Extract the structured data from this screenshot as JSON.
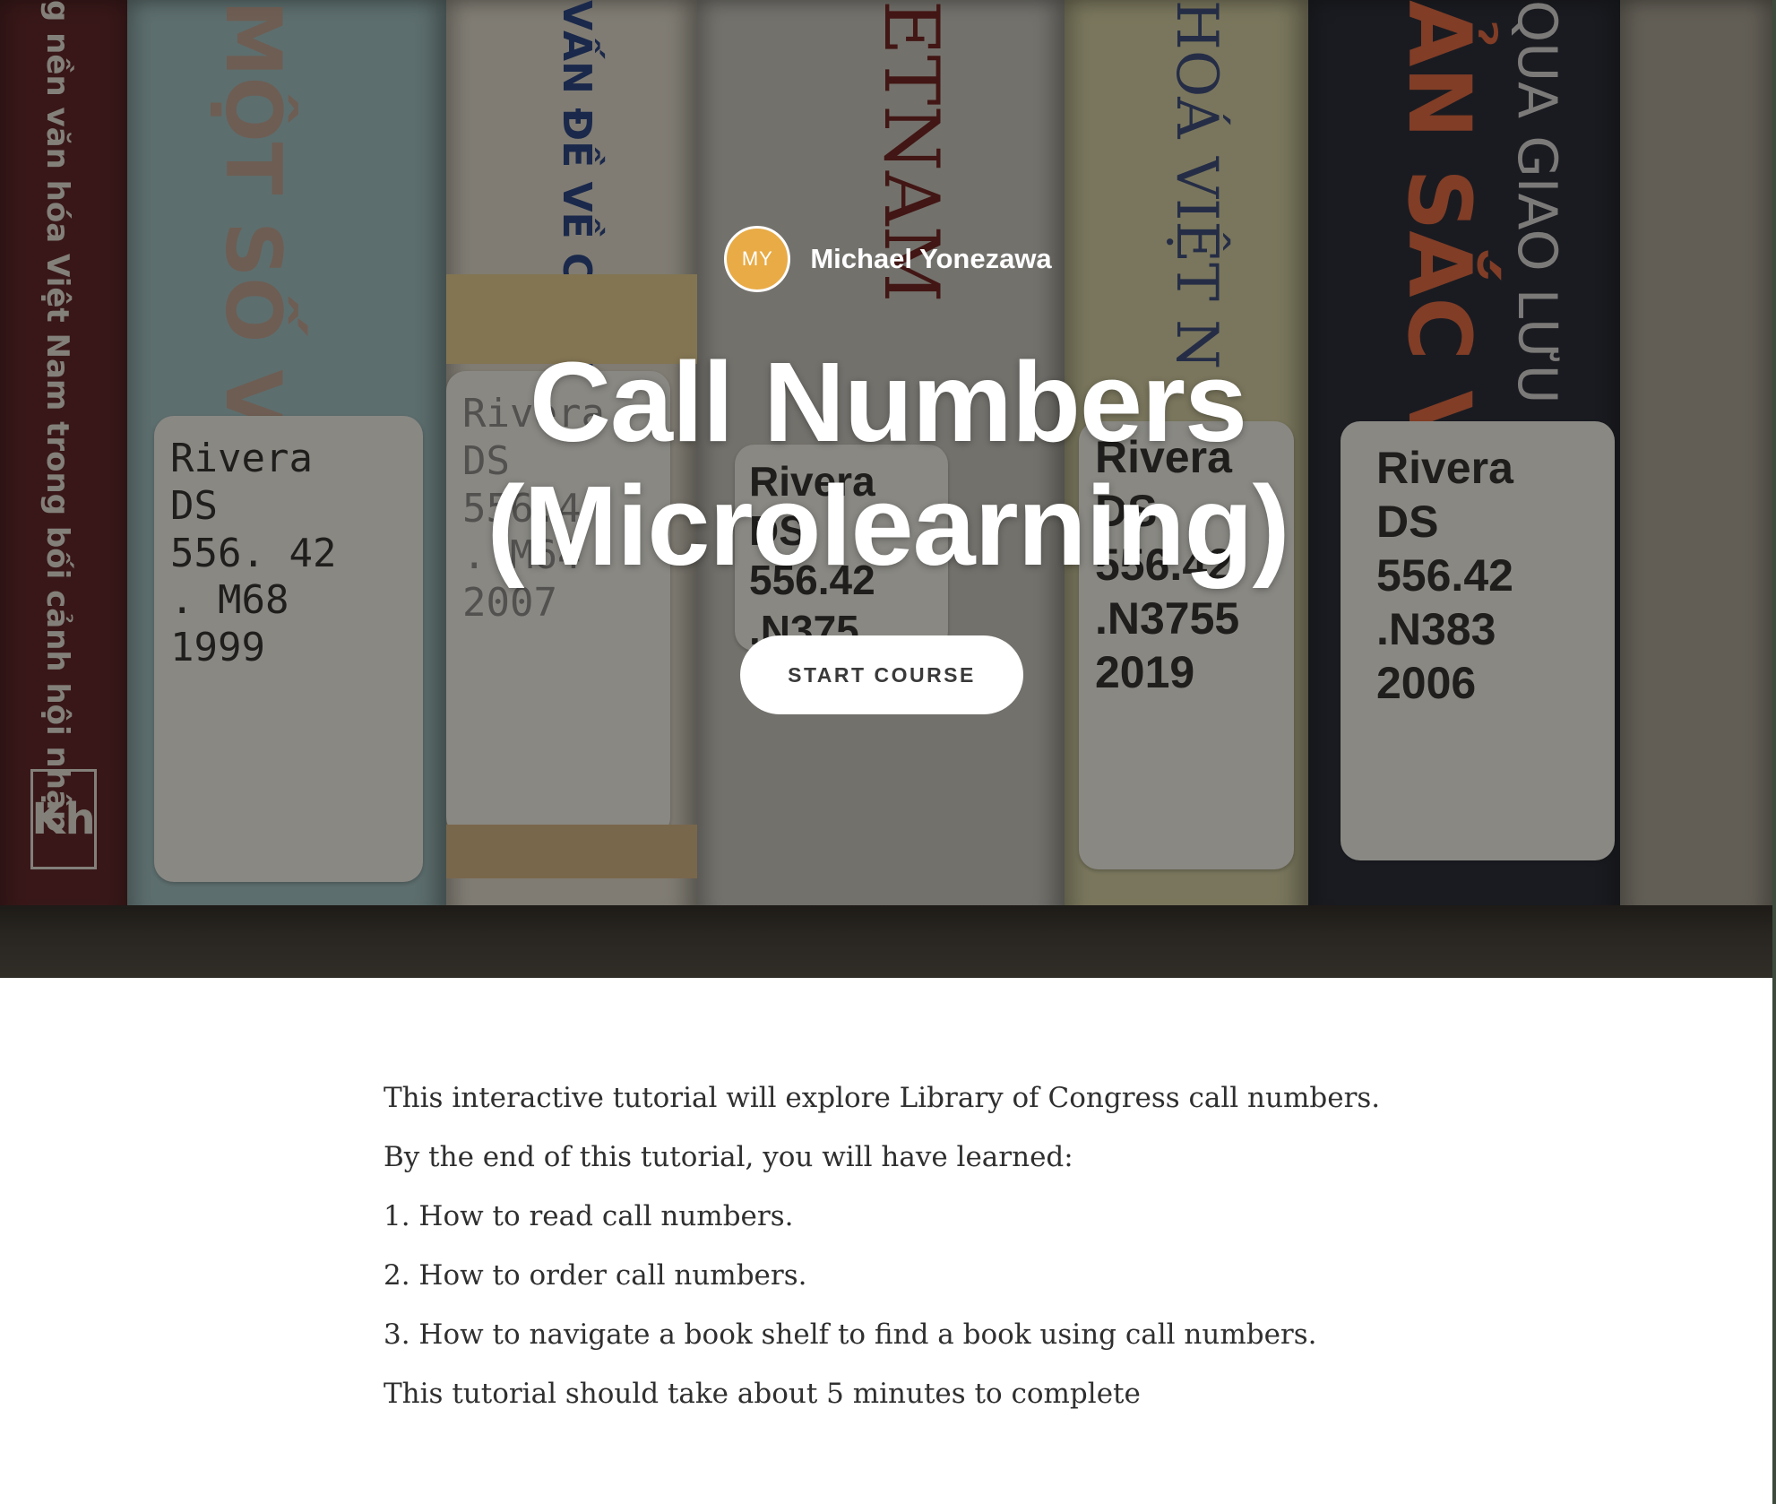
{
  "hero": {
    "author": {
      "initials": "MY",
      "name": "Michael Yonezawa"
    },
    "title_line1": "Call Numbers",
    "title_line2": "(Microlearning)",
    "start_button": "START COURSE",
    "background": {
      "spine_texts": [
        "g nền văn hóa Việt Nam trong bối cảnh hội nhập",
        "MỘT SỐ V",
        "VẤN ĐỀ VỀ CÔNG",
        "ETNAM",
        "HOÁ VIỆT N",
        "ẢN SẮC V",
        "QUA GIAO LƯU"
      ],
      "spine_labels": [
        [
          "Rivera",
          "DS",
          "556. 42",
          ". M68",
          "1999"
        ],
        [
          "Rivera",
          "DS",
          "556.4",
          ". M64",
          "2007"
        ],
        [
          "Rivera",
          "DS",
          "556.42",
          ".N375"
        ],
        [
          "Rivera",
          "DS",
          "556.42",
          ".N3755",
          "2019"
        ],
        [
          "Rivera",
          "DS",
          "556.42",
          ".N383",
          "2006"
        ]
      ],
      "publisher_logo": "Kh"
    }
  },
  "description": {
    "intro": "This interactive tutorial will explore Library of Congress call numbers.",
    "lead": "By the end of this tutorial, you will have learned:",
    "points": [
      "1. How to read call numbers.",
      "2. How to order call numbers.",
      "3. How to navigate a book shelf to find a book using call numbers."
    ],
    "duration": "This tutorial should take about 5 minutes to complete"
  },
  "colors": {
    "avatar": "#e8ab46",
    "button_bg": "#ffffff",
    "button_text": "#3a3a3a",
    "body_text": "#2f2f2f",
    "hero_overlay": "#14120f"
  }
}
